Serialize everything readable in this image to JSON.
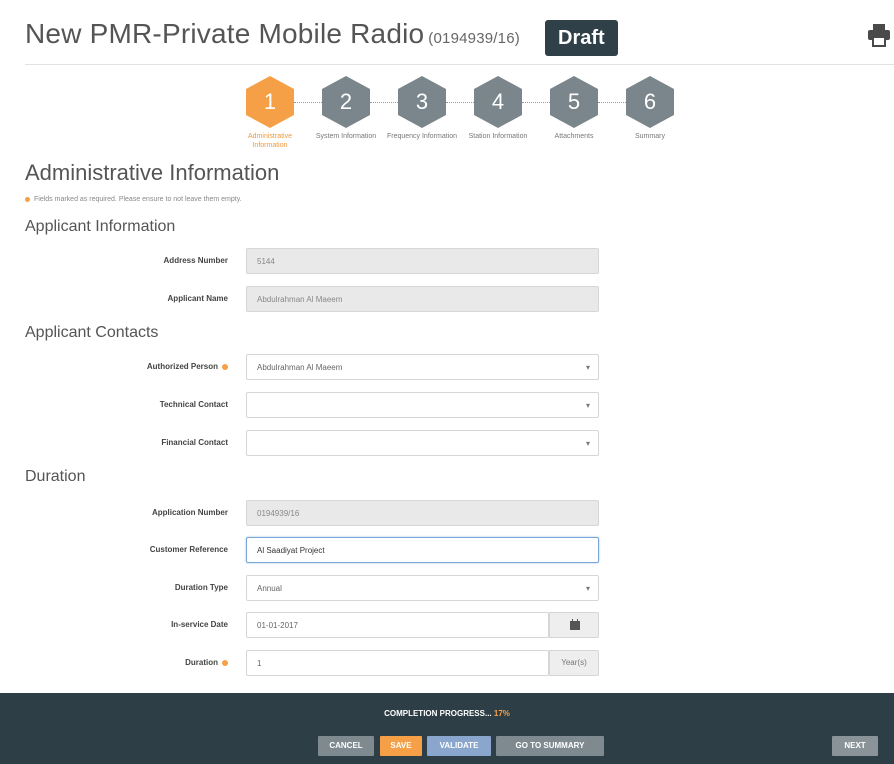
{
  "header": {
    "title": "New PMR-Private Mobile Radio",
    "reference": "(0194939/16)",
    "status": "Draft",
    "print_icon": "printer-icon"
  },
  "stepper": {
    "steps": [
      {
        "number": "1",
        "label": "Administrative Information",
        "active": true
      },
      {
        "number": "2",
        "label": "System Information",
        "active": false
      },
      {
        "number": "3",
        "label": "Frequency Information",
        "active": false
      },
      {
        "number": "4",
        "label": "Station Information",
        "active": false
      },
      {
        "number": "5",
        "label": "Attachments",
        "active": false
      },
      {
        "number": "6",
        "label": "Summary",
        "active": false
      }
    ]
  },
  "main": {
    "title": "Administrative Information",
    "required_note": "Fields marked as required. Please ensure to not leave them empty."
  },
  "applicant_info": {
    "heading": "Applicant Information",
    "address_number_label": "Address Number",
    "address_number_value": "5144",
    "applicant_name_label": "Applicant Name",
    "applicant_name_value": "Abdulrahman Al Maeem"
  },
  "applicant_contacts": {
    "heading": "Applicant Contacts",
    "authorized_person_label": "Authorized Person",
    "authorized_person_value": "Abdulrahman Al Maeem",
    "technical_contact_label": "Technical Contact",
    "technical_contact_value": "",
    "financial_contact_label": "Financial Contact",
    "financial_contact_value": ""
  },
  "duration": {
    "heading": "Duration",
    "application_number_label": "Application Number",
    "application_number_value": "0194939/16",
    "customer_reference_label": "Customer Reference",
    "customer_reference_value": "Al Saadiyat Project",
    "duration_type_label": "Duration Type",
    "duration_type_value": "Annual",
    "in_service_date_label": "In-service Date",
    "in_service_date_value": "01-01-2017",
    "duration_label": "Duration",
    "duration_value": "1",
    "duration_unit": "Year(s)"
  },
  "footer": {
    "progress_label": "COMPLETION PROGRESS...",
    "progress_percent": "17%",
    "progress_value": 0.17,
    "cancel": "CANCEL",
    "save": "SAVE",
    "validate": "VALIDATE",
    "go_to_summary": "GO TO SUMMARY",
    "next": "NEXT"
  },
  "colors": {
    "accent": "#f5a046",
    "badge": "#2f4048",
    "footer_bg": "#2e3e46",
    "step_inactive": "#7b868c"
  }
}
